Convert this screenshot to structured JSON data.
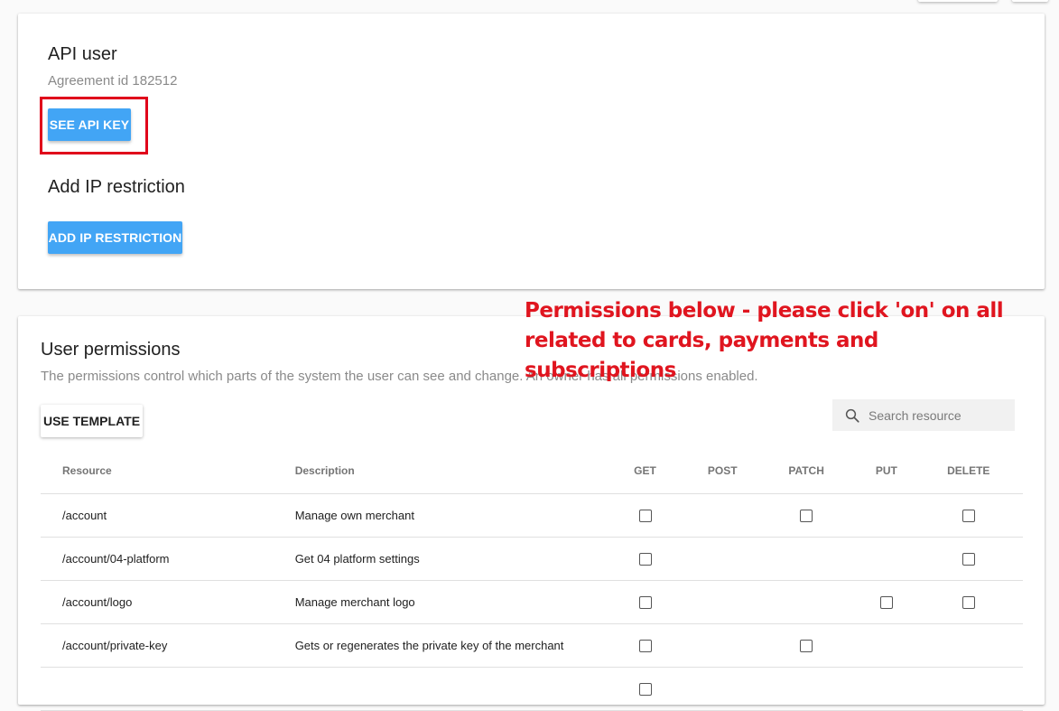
{
  "api_card": {
    "title": "API user",
    "agreement": "Agreement id 182512",
    "see_api_key_label": "SEE API KEY",
    "ip_title": "Add IP restriction",
    "add_ip_label": "ADD IP RESTRICTION"
  },
  "annotation": {
    "line1": "Permissions below - please click 'on' on all",
    "line2": "related to cards, payments and subscriptions",
    "color": "#e0151f"
  },
  "permissions": {
    "title": "User permissions",
    "description": "The permissions control which parts of the system the user can see and change. An owner has all permissions enabled.",
    "use_template_label": "USE TEMPLATE",
    "search_placeholder": "Search resource",
    "columns": [
      "Resource",
      "Description",
      "GET",
      "POST",
      "PATCH",
      "PUT",
      "DELETE"
    ],
    "rows": [
      {
        "resource": "/account",
        "description": "Manage own merchant",
        "get": true,
        "post": false,
        "patch": true,
        "put": false,
        "delete": true
      },
      {
        "resource": "/account/04-platform",
        "description": "Get 04 platform settings",
        "get": true,
        "post": false,
        "patch": false,
        "put": false,
        "delete": true
      },
      {
        "resource": "/account/logo",
        "description": "Manage merchant logo",
        "get": true,
        "post": false,
        "patch": false,
        "put": true,
        "delete": true
      },
      {
        "resource": "/account/private-key",
        "description": "Gets or regenerates the private key of the merchant",
        "get": true,
        "post": false,
        "patch": true,
        "put": false,
        "delete": false
      },
      {
        "resource": "",
        "description": "",
        "get": true,
        "post": false,
        "patch": false,
        "put": false,
        "delete": false
      }
    ]
  },
  "colors": {
    "primary_button": "#42a5f5",
    "highlight_box": "#e0001a"
  }
}
